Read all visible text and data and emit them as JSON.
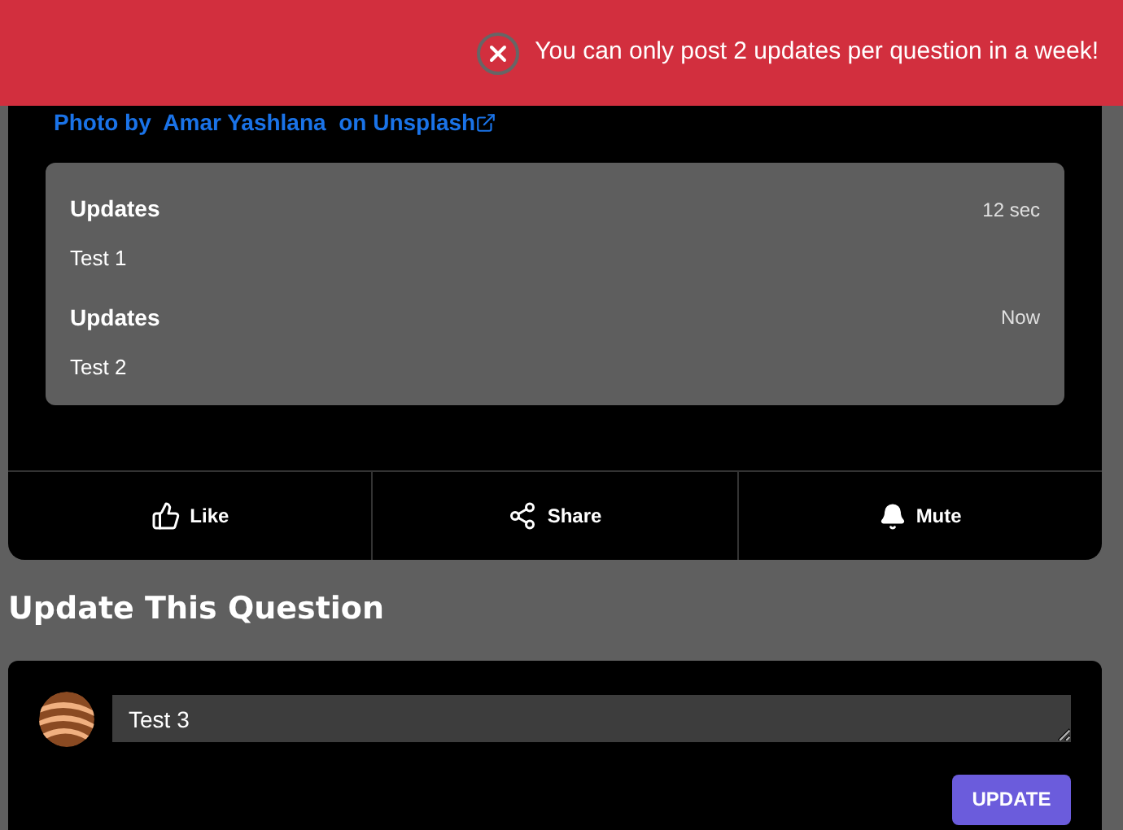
{
  "toast": {
    "message": "You can only post 2 updates per question in a week!"
  },
  "photo_credit": {
    "prefix": "Photo by ",
    "author": "Amar Yashlana",
    "middle": " on ",
    "site": "Unsplash"
  },
  "updates": [
    {
      "title": "Updates",
      "time": "12 sec",
      "text": "Test 1"
    },
    {
      "title": "Updates",
      "time": "Now",
      "text": "Test 2"
    }
  ],
  "actions": [
    {
      "kind": "like",
      "label": "Like"
    },
    {
      "kind": "share",
      "label": "Share"
    },
    {
      "kind": "mute",
      "label": "Mute"
    }
  ],
  "update_section": {
    "heading": "Update This Question",
    "value": "Test 3",
    "button": "UPDATE"
  }
}
